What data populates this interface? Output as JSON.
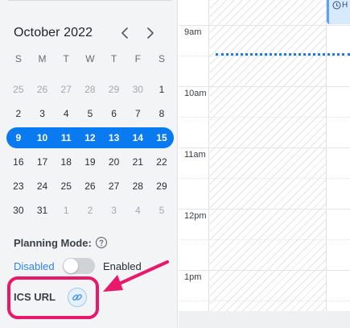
{
  "calendar": {
    "month_title": "October 2022",
    "weekdays": [
      "S",
      "M",
      "T",
      "W",
      "T",
      "F",
      "S"
    ],
    "weeks": [
      [
        {
          "d": "25",
          "m": true
        },
        {
          "d": "26",
          "m": true
        },
        {
          "d": "27",
          "m": true
        },
        {
          "d": "28",
          "m": true
        },
        {
          "d": "29",
          "m": true
        },
        {
          "d": "30",
          "m": true
        },
        {
          "d": "1",
          "m": false
        }
      ],
      [
        {
          "d": "2",
          "m": false
        },
        {
          "d": "3",
          "m": false
        },
        {
          "d": "4",
          "m": false
        },
        {
          "d": "5",
          "m": false
        },
        {
          "d": "6",
          "m": false
        },
        {
          "d": "7",
          "m": false
        },
        {
          "d": "8",
          "m": false
        }
      ],
      [
        {
          "d": "9",
          "m": false
        },
        {
          "d": "10",
          "m": false
        },
        {
          "d": "11",
          "m": false
        },
        {
          "d": "12",
          "m": false
        },
        {
          "d": "13",
          "m": false
        },
        {
          "d": "14",
          "m": false
        },
        {
          "d": "15",
          "m": false
        }
      ],
      [
        {
          "d": "16",
          "m": false
        },
        {
          "d": "17",
          "m": false
        },
        {
          "d": "18",
          "m": false
        },
        {
          "d": "19",
          "m": false
        },
        {
          "d": "20",
          "m": false
        },
        {
          "d": "21",
          "m": false
        },
        {
          "d": "22",
          "m": false
        }
      ],
      [
        {
          "d": "23",
          "m": false
        },
        {
          "d": "24",
          "m": false
        },
        {
          "d": "25",
          "m": false
        },
        {
          "d": "26",
          "m": false
        },
        {
          "d": "27",
          "m": false
        },
        {
          "d": "28",
          "m": false
        },
        {
          "d": "29",
          "m": false
        }
      ],
      [
        {
          "d": "30",
          "m": false
        },
        {
          "d": "31",
          "m": false
        },
        {
          "d": "1",
          "m": true
        },
        {
          "d": "2",
          "m": true
        },
        {
          "d": "3",
          "m": true
        },
        {
          "d": "4",
          "m": true
        },
        {
          "d": "5",
          "m": true
        }
      ]
    ],
    "selected_week_index": 2,
    "prev_icon": "chevron-left-icon",
    "next_icon": "chevron-right-icon"
  },
  "planning": {
    "label": "Planning Mode:",
    "help_icon": "question-circle-icon",
    "disabled_label": "Disabled",
    "enabled_label": "Enabled",
    "toggle_on": false
  },
  "ics": {
    "label": "ICS URL",
    "link_icon": "link-icon"
  },
  "timegrid": {
    "hours": [
      "9am",
      "10am",
      "11am",
      "12pm",
      "1pm"
    ],
    "event": {
      "text": "H",
      "icon": "clock-icon"
    }
  },
  "colors": {
    "accent": "#0a7af0",
    "highlight": "#e8186b",
    "link_text": "#2d87e8"
  }
}
